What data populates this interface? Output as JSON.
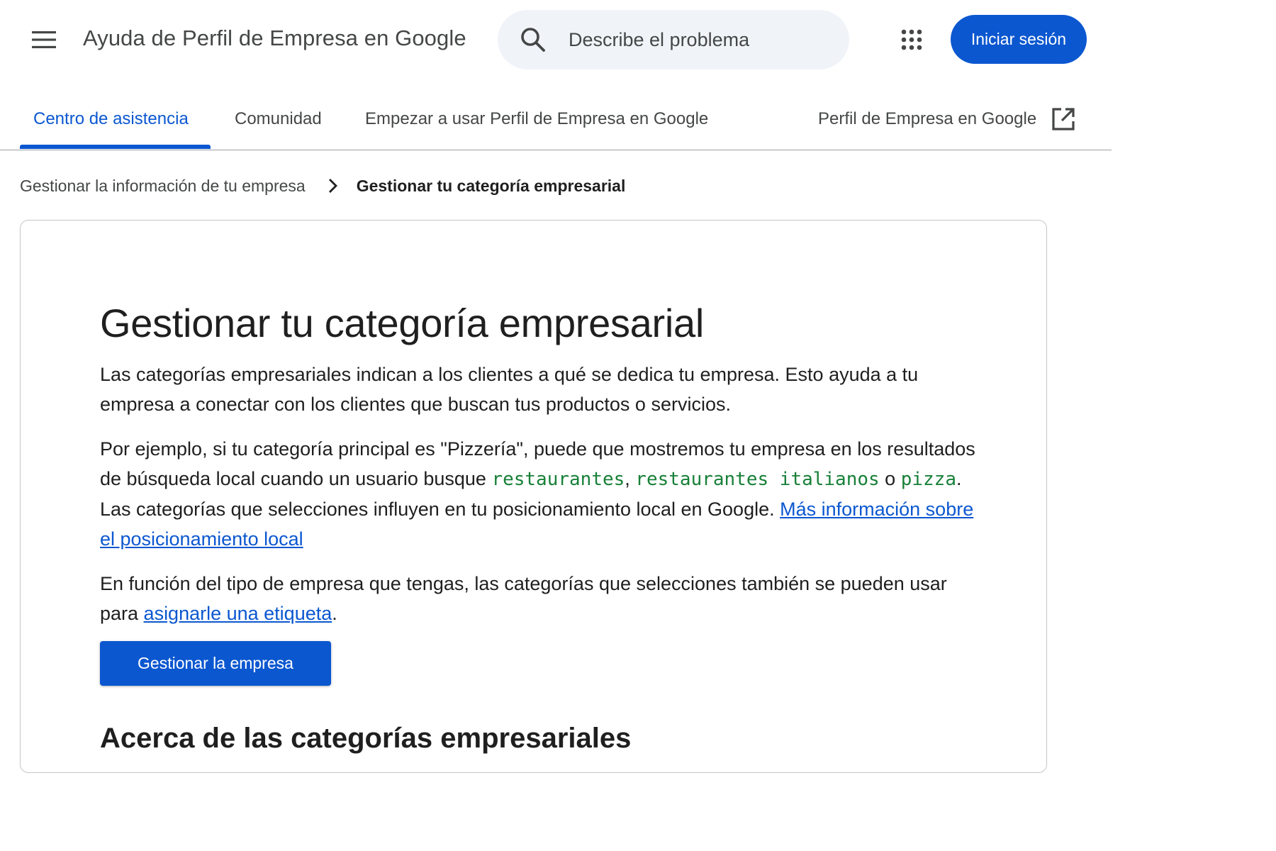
{
  "header": {
    "app_title": "Ayuda de Perfil de Empresa en Google",
    "search_placeholder": "Describe el problema",
    "signin_label": "Iniciar sesión"
  },
  "tabs": [
    {
      "label": "Centro de asistencia",
      "active": true
    },
    {
      "label": "Comunidad",
      "active": false
    },
    {
      "label": "Empezar a usar Perfil de Empresa en Google",
      "active": false
    },
    {
      "label": "Perfil de Empresa en Google",
      "active": false,
      "external": true
    }
  ],
  "breadcrumb": {
    "parent": "Gestionar la información de tu empresa",
    "current": "Gestionar tu categoría empresarial"
  },
  "article": {
    "title": "Gestionar tu categoría empresarial",
    "p1": "Las categorías empresariales indican a los clientes a qué se dedica tu empresa. Esto ayuda a tu empresa a conectar con los clientes que buscan tus productos o servicios.",
    "p2_a": "Por ejemplo, si tu categoría principal es \"Pizzería\", puede que mostremos tu empresa en los resultados de búsqueda local cuando un usuario busque ",
    "p2_code1": "restaurantes",
    "p2_sep1": ", ",
    "p2_code2": "restaurantes italianos",
    "p2_sep2": " o ",
    "p2_code3": "pizza",
    "p2_b": ". Las categorías que selecciones influyen en tu posicionamiento local en Google. ",
    "p2_link": "Más información sobre el posicionamiento local",
    "p3_a": "En función del tipo de empresa que tengas, las categorías que selecciones también se pueden usar para ",
    "p3_link": "asignarle una etiqueta",
    "p3_b": ".",
    "button_label": "Gestionar la empresa",
    "section_heading": "Acerca de las categorías empresariales"
  },
  "colors": {
    "accent": "#0b57d0",
    "code": "#188038",
    "search_bg": "#f0f4f9"
  },
  "icons": [
    "menu-icon",
    "search-icon",
    "apps-grid-icon",
    "external-link-icon",
    "chevron-right-icon"
  ]
}
